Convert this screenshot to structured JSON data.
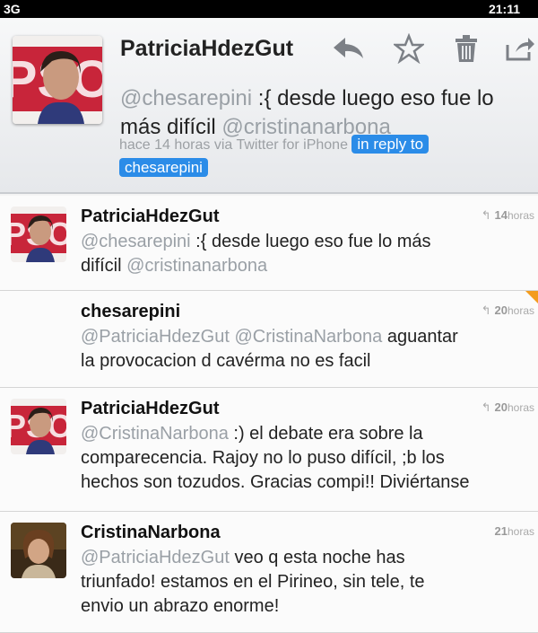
{
  "status": {
    "carrier": "3G",
    "time": "21:11"
  },
  "detail": {
    "name": "PatriciaHdezGut",
    "reply_to_mention": "@chesarepini",
    "body": " :{ desde luego eso fue lo más difícil ",
    "mention_2": "@cristinanarbona",
    "time": "hace 14 horas",
    "via": " via Twitter for iPhone ",
    "in_reply_label": "in reply to",
    "in_reply_user": "chesarepini",
    "icons": [
      "reply-icon",
      "star-icon",
      "trash-icon",
      "share-icon"
    ]
  },
  "tweets": [
    {
      "name": "PatriciaHdezGut",
      "time_num": "14",
      "time_unit": "horas",
      "line1_mention": "@chesarepini",
      "line1_text": " :{ desde luego eso fue lo más",
      "line2_text": "difícil ",
      "line2_mention": " @cristinanarbona"
    },
    {
      "name": "chesarepini",
      "time_num": "20",
      "time_unit": "horas",
      "line1_mention": "@PatriciaHdezGut @CristinaNarbona",
      "line1_text": " aguantar",
      "line2_text": "la provocacion d cavérma no es facil"
    },
    {
      "name": "PatriciaHdezGut",
      "time_num": "20",
      "time_unit": "horas",
      "line1_mention": "@CristinaNarbona",
      "line1_text": " :) el debate era sobre la",
      "line2_text": "comparecencia. Rajoy no lo puso difícil, ;b los",
      "line3_text": "hechos son tozudos. Gracias compi!! Diviértanse"
    },
    {
      "name": "CristinaNarbona",
      "time_num": "21",
      "time_unit": "horas",
      "line1_mention": "@PatriciaHdezGut",
      "line1_text": " veo q esta noche has",
      "line2_text": "triunfado! estamos en el Pirineo, sin tele, te",
      "line3_text": "envio un abrazo enorme!"
    }
  ],
  "colors": {
    "link_pill": "#2b8ce8",
    "mention": "#9aa0a6",
    "unread_marker": "#f39c1f"
  }
}
